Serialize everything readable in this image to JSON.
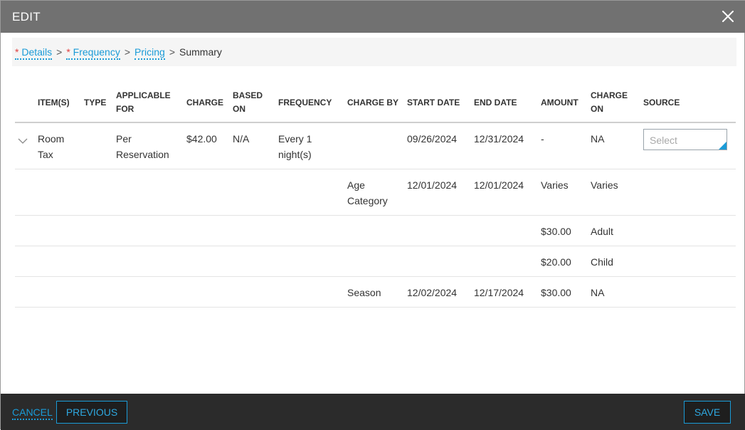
{
  "dialog": {
    "title": "EDIT"
  },
  "breadcrumb": {
    "required_mark": "*",
    "separator": ">",
    "steps": [
      "Details",
      "Frequency",
      "Pricing",
      "Summary"
    ]
  },
  "table": {
    "headers": {
      "items": "ITEM(S)",
      "type": "TYPE",
      "applicable_for": "APPLICABLE FOR",
      "charge": "CHARGE",
      "based_on": "BASED ON",
      "frequency": "FREQUENCY",
      "charge_by": "CHARGE BY",
      "start_date": "START DATE",
      "end_date": "END DATE",
      "amount": "AMOUNT",
      "charge_on": "CHARGE ON",
      "source": "SOURCE"
    },
    "rows": [
      {
        "item": "Room Tax",
        "type": "",
        "applicable_for": "Per Reservation",
        "charge": "$42.00",
        "based_on": "N/A",
        "frequency": "Every 1 night(s)",
        "charge_by": "",
        "start_date": "09/26/2024",
        "end_date": "12/31/2024",
        "amount": "-",
        "charge_on": "NA",
        "source_placeholder": "Select"
      },
      {
        "charge_by": "Age Category",
        "start_date": "12/01/2024",
        "end_date": "12/01/2024",
        "amount": "Varies",
        "charge_on": "Varies"
      },
      {
        "amount": "$30.00",
        "charge_on": "Adult"
      },
      {
        "amount": "$20.00",
        "charge_on": "Child"
      },
      {
        "charge_by": "Season",
        "start_date": "12/02/2024",
        "end_date": "12/17/2024",
        "amount": "$30.00",
        "charge_on": "NA"
      }
    ]
  },
  "footer": {
    "cancel_label": "CANCEL",
    "previous_label": "PREVIOUS",
    "save_label": "SAVE"
  },
  "icons": {
    "close": "close-icon",
    "expand": "chevron-down-icon",
    "select_corner": "dropdown-corner-icon"
  },
  "colors": {
    "titlebar": "#717171",
    "accent": "#1a9bd7",
    "required": "#e04040",
    "footer": "#2b2b2b"
  }
}
